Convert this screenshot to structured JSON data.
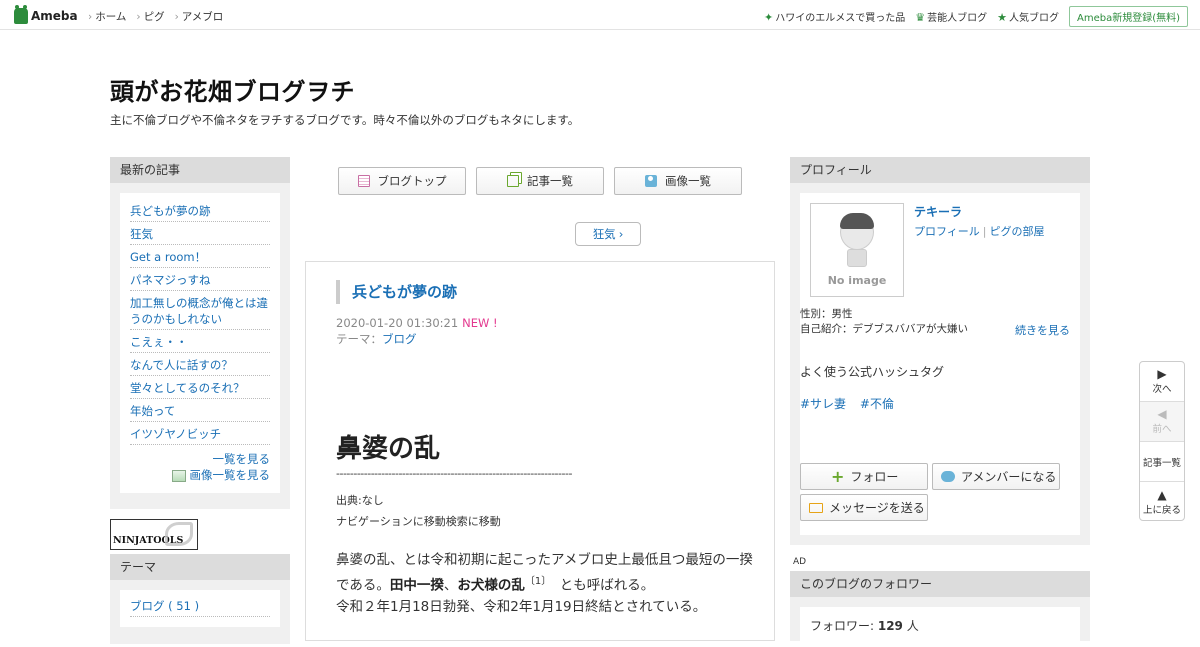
{
  "topbar": {
    "logo": "Ameba",
    "nav": [
      "ホーム",
      "ピグ",
      "アメブロ"
    ],
    "links": [
      {
        "icon": "leaf-icon",
        "label": "ハワイのエルメスで買った品"
      },
      {
        "icon": "crown-icon",
        "label": "芸能人ブログ"
      },
      {
        "icon": "star-icon",
        "label": "人気ブログ"
      }
    ],
    "register": "Ameba新規登録(無料)"
  },
  "header": {
    "title": "頭がお花畑ブログヲチ",
    "description": "主に不倫ブログや不倫ネタをヲチするブログです。時々不倫以外のブログもネタにします。"
  },
  "left": {
    "latest_heading": "最新の記事",
    "latest": [
      "兵どもが夢の跡",
      "狂気",
      "Get a room！",
      "パネマジっすね",
      "加工無しの概念が俺とは違うのかもしれない",
      "こえぇ・・",
      "なんで人に話すの？",
      "堂々としてるのそれ？",
      "年始って",
      "イツゾヤノビッチ"
    ],
    "see_all": "一覧を見る",
    "see_images": "画像一覧を見る",
    "ninja": "NINJATOOLS",
    "theme_heading": "テーマ",
    "themes": [
      "ブログ ( 51 )"
    ]
  },
  "center": {
    "nav_buttons": [
      {
        "icon": "blog-top-icon",
        "label": "ブログトップ"
      },
      {
        "icon": "article-list-icon",
        "label": "記事一覧"
      },
      {
        "icon": "camera-icon",
        "label": "画像一覧"
      }
    ],
    "next_link": "狂気",
    "article": {
      "title": "兵どもが夢の跡",
      "date": "2020-01-20 01:30:21",
      "new_badge": "NEW !",
      "theme_label": "テーマ：",
      "theme": "ブログ",
      "heading": "鼻婆の乱",
      "separator": "--------------------------------------------------------------------",
      "source": "出典:なし",
      "nav_note": "ナビゲーションに移動検索に移動",
      "body_1": "鼻婆の乱、とは令和初期に起こったアメブロ史上最低且つ最短の一揆である。",
      "body_b1": "田中一揆",
      "body_2": "、",
      "body_b2": "お犬様の乱",
      "body_sup": "〔1〕",
      "body_3": "　とも呼ばれる。",
      "body_4": "令和２年1月18日勃発、令和2年1月19日終結とされている。"
    }
  },
  "right": {
    "profile_heading": "プロフィール",
    "no_image": "No image",
    "name": "テキーラ",
    "profile_link": "プロフィール",
    "pig_link": "ピグの部屋",
    "gender": "性別：男性",
    "intro": "自己紹介：デブブスババアが大嫌い",
    "more": "続きを見る",
    "hashtag_heading": "よく使う公式ハッシュタグ",
    "hashtags": [
      "#サレ妻",
      "#不倫"
    ],
    "follow": "フォロー",
    "amember": "アメンバーになる",
    "message": "メッセージを送る",
    "ad": "AD",
    "followers_heading": "このブログのフォロワー",
    "followers_label": "フォロワー: ",
    "followers_count": "129",
    "followers_unit": " 人"
  },
  "floatnav": {
    "next": "次へ",
    "prev": "前へ",
    "list": "記事一覧",
    "top": "上に戻る"
  },
  "colors": {
    "link": "#1a6fb5",
    "ameba_green": "#2d8c3c",
    "new_badge": "#e3398f",
    "sidebar_head": "#dcdcdc"
  }
}
